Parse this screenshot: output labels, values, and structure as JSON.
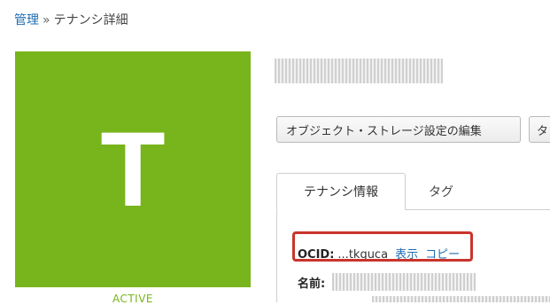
{
  "breadcrumb": {
    "root": "管理",
    "separator": "»",
    "current": "テナンシ詳細"
  },
  "tenancy_tile": {
    "letter": "T",
    "status": "ACTIVE",
    "color": "#78b41c"
  },
  "title": "",
  "buttons": {
    "edit_object_storage": "オブジェクト・ストレージ設定の編集",
    "second": "タ"
  },
  "tabs": [
    {
      "label": "テナンシ情報",
      "active": true
    },
    {
      "label": "タグ",
      "active": false
    }
  ],
  "details": {
    "ocid_label": "OCID:",
    "ocid_value": "...tkguca",
    "show_link": "表示",
    "copy_link": "コピー",
    "name_label": "名前:"
  },
  "colors": {
    "link": "#1f6db3",
    "highlight": "#c9342c"
  },
  "icons": []
}
